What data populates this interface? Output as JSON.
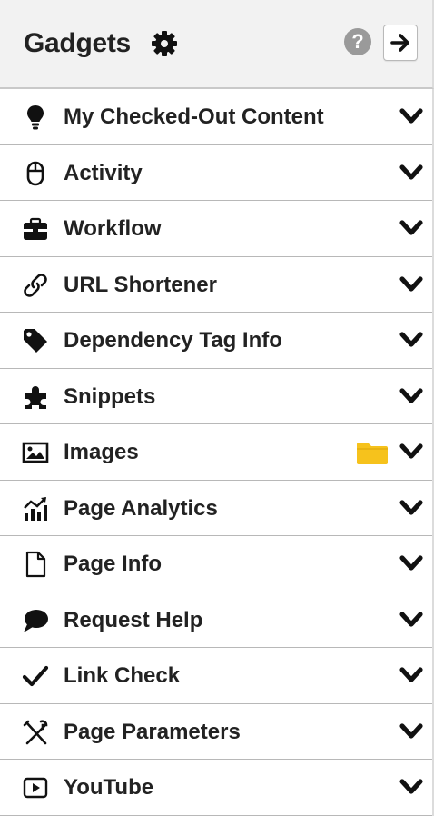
{
  "header": {
    "title": "Gadgets",
    "help_label": "?",
    "accent_colors": {
      "text": "#222222",
      "help_bg": "#9a9a9a",
      "folder": "#f6c21c"
    }
  },
  "gadgets": [
    {
      "label": "My Checked-Out Content",
      "icon": "lightbulb-icon"
    },
    {
      "label": "Activity",
      "icon": "mouse-icon"
    },
    {
      "label": "Workflow",
      "icon": "briefcase-icon"
    },
    {
      "label": "URL Shortener",
      "icon": "link-icon"
    },
    {
      "label": "Dependency Tag Info",
      "icon": "tag-icon"
    },
    {
      "label": "Snippets",
      "icon": "puzzle-icon"
    },
    {
      "label": "Images",
      "icon": "image-icon",
      "extra_icon": "folder-icon"
    },
    {
      "label": "Page Analytics",
      "icon": "chart-icon"
    },
    {
      "label": "Page Info",
      "icon": "file-icon"
    },
    {
      "label": "Request Help",
      "icon": "speech-bubble-icon"
    },
    {
      "label": "Link Check",
      "icon": "checkmark-icon"
    },
    {
      "label": "Page Parameters",
      "icon": "tools-icon"
    },
    {
      "label": "YouTube",
      "icon": "play-icon"
    }
  ]
}
